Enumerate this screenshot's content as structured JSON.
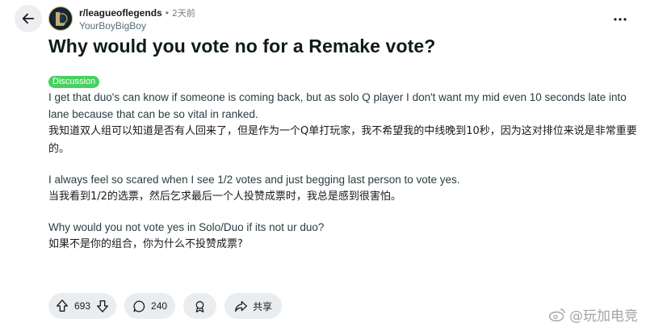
{
  "header": {
    "subreddit": "r/leagueoflegends",
    "separator": "•",
    "time": "2天前",
    "author": "YourBoyBigBoy"
  },
  "post": {
    "title": "Why would you vote no for a Remake vote?",
    "flair": "Discussion",
    "flair_color": "#46d160",
    "paragraphs": [
      {
        "en": "I get that duo's can know if someone is coming back, but as solo Q player I don't want my mid even 10 seconds late into lane because that can be so vital in ranked.",
        "zh": "我知道双人组可以知道是否有人回来了，但是作为一个Q单打玩家，我不希望我的中线晚到10秒，因为这对排位来说是非常重要的。"
      },
      {
        "en": "I always feel so scared when I see 1/2 votes and just begging last person to vote yes.",
        "zh": "当我看到1/2的选票，然后乞求最后一个人投赞成票时，我总是感到很害怕。"
      },
      {
        "en": "Why would you not vote yes in Solo/Duo if its not ur duo?",
        "zh": "如果不是你的组合，你为什么不投赞成票?"
      }
    ]
  },
  "actions": {
    "upvotes": "693",
    "comments": "240",
    "share_label": "共享"
  },
  "icons": {
    "back": "arrow-left-icon",
    "more": "more-horizontal-icon",
    "upvote": "arrow-up-icon",
    "downvote": "arrow-down-icon",
    "comment": "comment-bubble-icon",
    "award": "award-icon",
    "share": "share-arrow-icon"
  },
  "watermark": "@玩加电竞"
}
